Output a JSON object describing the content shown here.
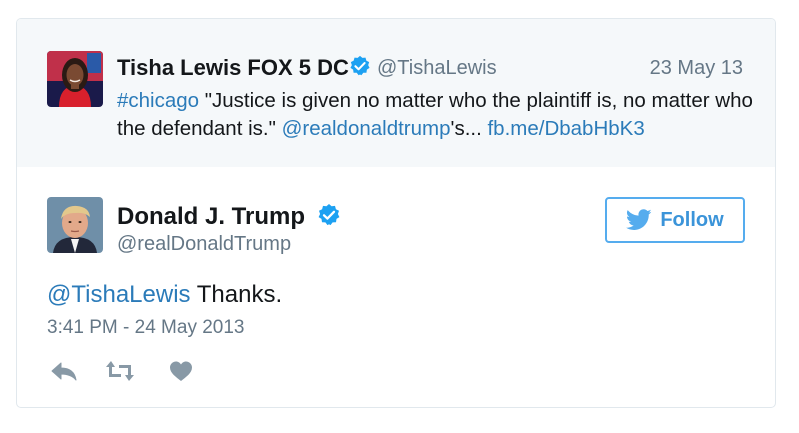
{
  "quoted_tweet": {
    "author_name": "Tisha Lewis FOX 5 DC",
    "handle": "@TishaLewis",
    "date": "23 May 13",
    "hashtag": "#chicago",
    "text_part1": " \"Justice is given no matter who the plaintiff is, no matter who the defendant is.\" ",
    "mention": "@realdonaldtrump",
    "text_part2": "'s... ",
    "link": "fb.me/DbabHbK3",
    "verified_icon": "verified-badge-icon"
  },
  "tweet": {
    "author_name": "Donald J. Trump",
    "handle": "@realDonaldTrump",
    "mention": "@TishaLewis",
    "text": " Thanks.",
    "timestamp": "3:41 PM - 24 May 2013",
    "verified_icon": "verified-badge-icon"
  },
  "follow_button": {
    "label": "Follow",
    "icon": "twitter-bird-icon"
  },
  "actions": {
    "reply_icon": "reply-icon",
    "retweet_icon": "retweet-icon",
    "like_icon": "heart-icon"
  },
  "colors": {
    "link": "#2b7bb9",
    "verified": "#1da1f2",
    "follow_border": "#55acee",
    "muted": "#657786",
    "quoted_bg": "#f5f8fa"
  }
}
